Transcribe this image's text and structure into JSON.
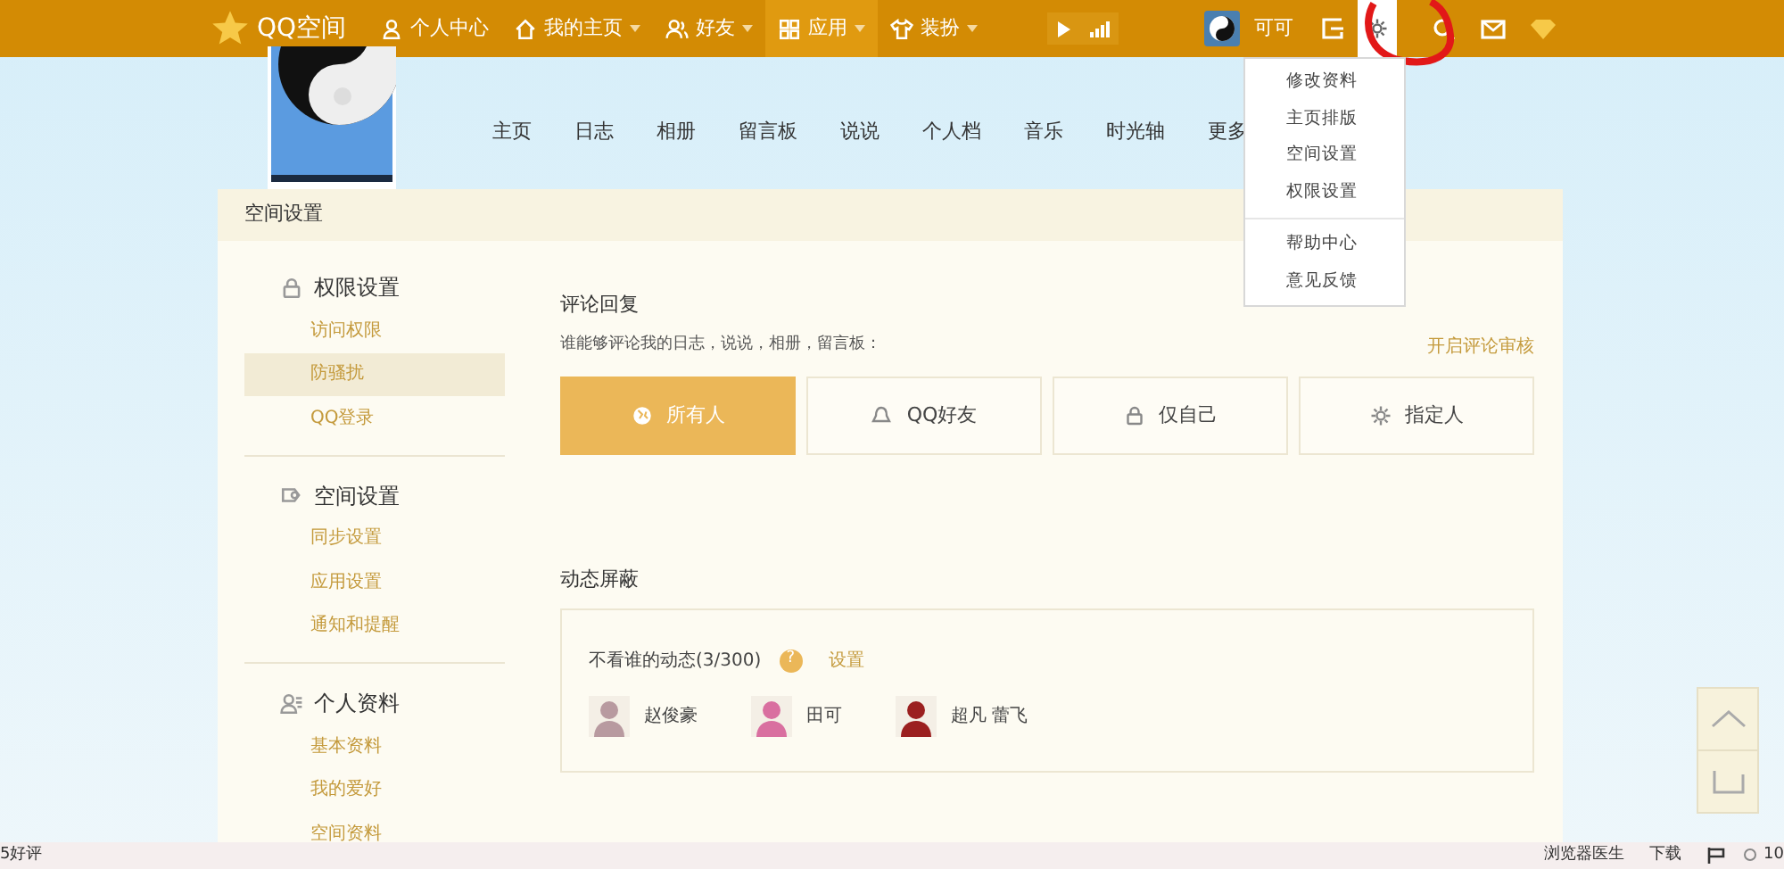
{
  "top_bar": {
    "logo": "QQ空间",
    "nav": [
      {
        "label": "个人中心",
        "dropdown": false,
        "selected": false
      },
      {
        "label": "我的主页",
        "dropdown": true,
        "selected": false
      },
      {
        "label": "好友",
        "dropdown": true,
        "selected": false
      },
      {
        "label": "应用",
        "dropdown": true,
        "selected": true
      },
      {
        "label": "装扮",
        "dropdown": true,
        "selected": false
      }
    ],
    "user_name": "可可"
  },
  "settings_menu": {
    "groups": [
      [
        "修改资料",
        "主页排版",
        "空间设置",
        "权限设置"
      ],
      [
        "帮助中心",
        "意见反馈"
      ]
    ]
  },
  "profile_tabs": [
    "主页",
    "日志",
    "相册",
    "留言板",
    "说说",
    "个人档",
    "音乐",
    "时光轴",
    "更多"
  ],
  "panel": {
    "title": "空间设置",
    "sidebar": [
      {
        "title": "权限设置",
        "items": [
          {
            "label": "访问权限",
            "selected": false
          },
          {
            "label": "防骚扰",
            "selected": true
          },
          {
            "label": "QQ登录",
            "selected": false
          }
        ]
      },
      {
        "title": "空间设置",
        "items": [
          {
            "label": "同步设置",
            "selected": false
          },
          {
            "label": "应用设置",
            "selected": false
          },
          {
            "label": "通知和提醒",
            "selected": false
          }
        ]
      },
      {
        "title": "个人资料",
        "items": [
          {
            "label": "基本资料",
            "selected": false
          },
          {
            "label": "我的爱好",
            "selected": false
          },
          {
            "label": "空间资料",
            "selected": false
          }
        ]
      }
    ],
    "comments": {
      "title": "评论回复",
      "question": "谁能够评论我的日志，说说，相册，留言板：",
      "link": "开启评论审核",
      "options": [
        {
          "label": "所有人",
          "selected": true
        },
        {
          "label": "QQ好友",
          "selected": false
        },
        {
          "label": "仅自己",
          "selected": false
        },
        {
          "label": "指定人",
          "selected": false
        }
      ]
    },
    "block": {
      "title": "动态屏蔽",
      "label": "不看谁的动态(3/300)",
      "help": "?",
      "link": "设置",
      "people": [
        {
          "name": "赵俊豪",
          "color": "#b89aa0"
        },
        {
          "name": "田可",
          "color": "#d96fa0"
        },
        {
          "name": "超凡 蕾飞",
          "color": "#9b2020"
        }
      ]
    }
  },
  "status_bar": {
    "left": "5好评",
    "items": [
      "浏览器医生",
      "下载"
    ],
    "zoom": "10"
  }
}
